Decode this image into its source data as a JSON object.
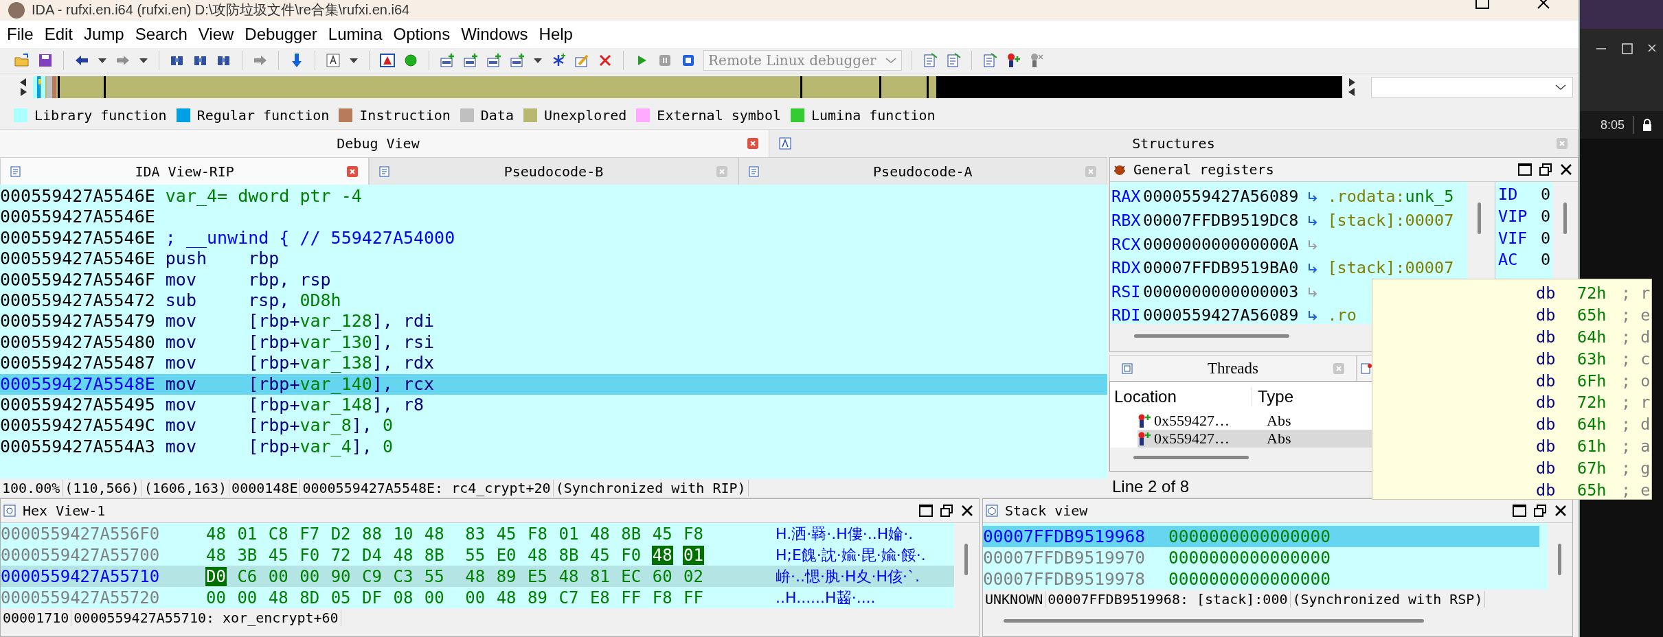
{
  "window": {
    "title": "IDA - rufxi.en.i64 (rufxi.en) D:\\攻防垃圾文件\\re合集\\rufxi.en.i64"
  },
  "menu": [
    "File",
    "Edit",
    "Jump",
    "Search",
    "View",
    "Debugger",
    "Lumina",
    "Options",
    "Windows",
    "Help"
  ],
  "toolbar": {
    "debugger_select": {
      "value": "Remote Linux debugger",
      "disabled": true
    }
  },
  "legend": [
    {
      "label": "Library function",
      "color": "#aaffff"
    },
    {
      "label": "Regular function",
      "color": "#00a0e6"
    },
    {
      "label": "Instruction",
      "color": "#b87c5c"
    },
    {
      "label": "Data",
      "color": "#c0c0c0"
    },
    {
      "label": "Unexplored",
      "color": "#b8b870"
    },
    {
      "label": "External symbol",
      "color": "#ffaaff"
    },
    {
      "label": "Lumina function",
      "color": "#33cc33"
    }
  ],
  "outer_tabs": [
    {
      "label": "Debug View",
      "selected": true
    },
    {
      "label": "Structures",
      "selected": false
    }
  ],
  "view_tabs": [
    {
      "label": "IDA View-RIP",
      "selected": true
    },
    {
      "label": "Pseudocode-B",
      "selected": false
    },
    {
      "label": "Pseudocode-A",
      "selected": false
    }
  ],
  "disassembly": [
    {
      "address": "000559427A5546E",
      "selected": false,
      "parts": [
        {
          "text": "var_4= dword ptr -4",
          "kind": "name"
        }
      ]
    },
    {
      "address": "000559427A5546E",
      "selected": false
    },
    {
      "address": "000559427A5546E",
      "selected": false,
      "parts": [
        {
          "text": "; __unwind { // 559427A54000",
          "kind": "comment"
        }
      ]
    },
    {
      "address": "000559427A5546E",
      "selected": false,
      "parts": [
        {
          "text": "push    rbp",
          "kind": "code"
        }
      ]
    },
    {
      "address": "000559427A5546F",
      "selected": false,
      "parts": [
        {
          "text": "mov     rbp, rsp",
          "kind": "code"
        }
      ]
    },
    {
      "address": "000559427A55472",
      "selected": false,
      "parts": [
        {
          "text": "sub     rsp, ",
          "kind": "code"
        },
        {
          "text": "0D8h",
          "kind": "number"
        }
      ]
    },
    {
      "address": "000559427A55479",
      "selected": false,
      "parts": [
        {
          "text": "mov     [rbp+",
          "kind": "code"
        },
        {
          "text": "var_128",
          "kind": "name"
        },
        {
          "text": "], rdi",
          "kind": "code"
        }
      ]
    },
    {
      "address": "000559427A55480",
      "selected": false,
      "parts": [
        {
          "text": "mov     [rbp+",
          "kind": "code"
        },
        {
          "text": "var_130",
          "kind": "name"
        },
        {
          "text": "], rsi",
          "kind": "code"
        }
      ]
    },
    {
      "address": "000559427A55487",
      "selected": false,
      "parts": [
        {
          "text": "mov     [rbp+",
          "kind": "code"
        },
        {
          "text": "var_138",
          "kind": "name"
        },
        {
          "text": "], rdx",
          "kind": "code"
        }
      ]
    },
    {
      "address": "000559427A5548E",
      "selected": true,
      "parts": [
        {
          "text": "mov     [rbp+",
          "kind": "code"
        },
        {
          "text": "var_140",
          "kind": "name"
        },
        {
          "text": "], rcx",
          "kind": "code"
        }
      ]
    },
    {
      "address": "000559427A55495",
      "selected": false,
      "parts": [
        {
          "text": "mov     [rbp+",
          "kind": "code"
        },
        {
          "text": "var_148",
          "kind": "name"
        },
        {
          "text": "], r8",
          "kind": "code"
        }
      ]
    },
    {
      "address": "000559427A5549C",
      "selected": false,
      "parts": [
        {
          "text": "mov     [rbp+",
          "kind": "code"
        },
        {
          "text": "var_8",
          "kind": "name"
        },
        {
          "text": "], ",
          "kind": "code"
        },
        {
          "text": "0",
          "kind": "number"
        }
      ]
    },
    {
      "address": "000559427A554A3",
      "selected": false,
      "parts": [
        {
          "text": "mov     [rbp+",
          "kind": "code"
        },
        {
          "text": "var_4",
          "kind": "name"
        },
        {
          "text": "], ",
          "kind": "code"
        },
        {
          "text": "0",
          "kind": "number"
        }
      ]
    }
  ],
  "disassembly_status": [
    "100.00%",
    "(110,566)",
    "(1606,163)",
    "0000148E",
    "0000559427A5548E: rc4_crypt+20",
    "(Synchronized with RIP)"
  ],
  "registers": {
    "title": "General registers",
    "rows": [
      {
        "name": "RAX",
        "value": "0000559427A56089",
        "points": true,
        "parts": [
          {
            "text": ".rodata:",
            "kind": "segment"
          },
          {
            "text": "unk_5",
            "kind": "name"
          }
        ]
      },
      {
        "name": "RBX",
        "value": "00007FFDB9519DC8",
        "points": true,
        "parts": [
          {
            "text": "[stack]:00007",
            "kind": "segment"
          }
        ]
      },
      {
        "name": "RCX",
        "value": "000000000000000A",
        "points": false
      },
      {
        "name": "RDX",
        "value": "00007FFDB9519BA0",
        "points": true,
        "parts": [
          {
            "text": "[stack]:00007",
            "kind": "segment"
          }
        ]
      },
      {
        "name": "RSI",
        "value": "0000000000000003",
        "points": false
      },
      {
        "name": "RDI",
        "value": "0000559427A56089",
        "points": true,
        "parts": [
          {
            "text": ".ro",
            "kind": "segment"
          }
        ]
      }
    ],
    "flags": [
      {
        "name": "ID",
        "value": "0"
      },
      {
        "name": "VIP",
        "value": "0"
      },
      {
        "name": "VIF",
        "value": "0"
      },
      {
        "name": "AC",
        "value": "0"
      }
    ]
  },
  "threads": {
    "tab": "Threads",
    "columns": [
      "Location",
      "Type"
    ],
    "rows": [
      {
        "location": "0x559427…",
        "type": "Abs",
        "selected": false
      },
      {
        "location": "0x559427…",
        "type": "Abs",
        "selected": true
      }
    ],
    "status": "Line 2 of 8"
  },
  "hint": [
    {
      "op": "db",
      "value": "72h",
      "comment": "; r"
    },
    {
      "op": "db",
      "value": "65h",
      "comment": "; e"
    },
    {
      "op": "db",
      "value": "64h",
      "comment": "; d"
    },
    {
      "op": "db",
      "value": "63h",
      "comment": "; c"
    },
    {
      "op": "db",
      "value": "6Fh",
      "comment": "; o"
    },
    {
      "op": "db",
      "value": "72h",
      "comment": "; r"
    },
    {
      "op": "db",
      "value": "64h",
      "comment": "; d"
    },
    {
      "op": "db",
      "value": "61h",
      "comment": "; a"
    },
    {
      "op": "db",
      "value": "67h",
      "comment": "; g"
    },
    {
      "op": "db",
      "value": "65h",
      "comment": "; e"
    }
  ],
  "hex": {
    "title": "Hex View-1",
    "rows": [
      {
        "address": "0000559427A556F0",
        "selected": false,
        "ascii": "H.洒·羇·.H僂·..H婨·.",
        "bytes": [
          {
            "byte": "48",
            "highlighted": false
          },
          {
            "byte": "01",
            "highlighted": false
          },
          {
            "byte": "C8",
            "highlighted": false
          },
          {
            "byte": "F7",
            "highlighted": false
          },
          {
            "byte": "D2",
            "highlighted": false
          },
          {
            "byte": "88",
            "highlighted": false
          },
          {
            "byte": "10",
            "highlighted": false
          },
          {
            "byte": "48",
            "highlighted": false
          },
          {
            "byte": "83",
            "highlighted": false
          },
          {
            "byte": "45",
            "highlighted": false
          },
          {
            "byte": "F8",
            "highlighted": false
          },
          {
            "byte": "01",
            "highlighted": false
          },
          {
            "byte": "48",
            "highlighted": false
          },
          {
            "byte": "8B",
            "highlighted": false
          },
          {
            "byte": "45",
            "highlighted": false
          },
          {
            "byte": "F8",
            "highlighted": false
          }
        ]
      },
      {
        "address": "0000559427A55700",
        "selected": false,
        "ascii": "H;E餽·訦·婾·毘·婾·餒·.",
        "bytes": [
          {
            "byte": "48",
            "highlighted": false
          },
          {
            "byte": "3B",
            "highlighted": false
          },
          {
            "byte": "45",
            "highlighted": false
          },
          {
            "byte": "F0",
            "highlighted": false
          },
          {
            "byte": "72",
            "highlighted": false
          },
          {
            "byte": "D4",
            "highlighted": false
          },
          {
            "byte": "48",
            "highlighted": false
          },
          {
            "byte": "8B",
            "highlighted": false
          },
          {
            "byte": "55",
            "highlighted": false
          },
          {
            "byte": "E0",
            "highlighted": false
          },
          {
            "byte": "48",
            "highlighted": false
          },
          {
            "byte": "8B",
            "highlighted": false
          },
          {
            "byte": "45",
            "highlighted": false
          },
          {
            "byte": "F0",
            "highlighted": false
          },
          {
            "byte": "48",
            "highlighted": true
          },
          {
            "byte": "01",
            "highlighted": true
          }
        ]
      },
      {
        "address": "0000559427A55710",
        "selected": true,
        "ascii": "峅·..愢·肒·H夊·H侅·`.",
        "bytes": [
          {
            "byte": "D0",
            "highlighted": true
          },
          {
            "byte": "C6",
            "highlighted": false
          },
          {
            "byte": "00",
            "highlighted": false
          },
          {
            "byte": "00",
            "highlighted": false
          },
          {
            "byte": "90",
            "highlighted": false
          },
          {
            "byte": "C9",
            "highlighted": false
          },
          {
            "byte": "C3",
            "highlighted": false
          },
          {
            "byte": "55",
            "highlighted": false
          },
          {
            "byte": "48",
            "highlighted": false
          },
          {
            "byte": "89",
            "highlighted": false
          },
          {
            "byte": "E5",
            "highlighted": false
          },
          {
            "byte": "48",
            "highlighted": false
          },
          {
            "byte": "81",
            "highlighted": false
          },
          {
            "byte": "EC",
            "highlighted": false
          },
          {
            "byte": "60",
            "highlighted": false
          },
          {
            "byte": "02",
            "highlighted": false
          }
        ]
      },
      {
        "address": "0000559427A55720",
        "selected": false,
        "ascii": "..H......H齧·....",
        "bytes": [
          {
            "byte": "00",
            "highlighted": false
          },
          {
            "byte": "00",
            "highlighted": false
          },
          {
            "byte": "48",
            "highlighted": false
          },
          {
            "byte": "8D",
            "highlighted": false
          },
          {
            "byte": "05",
            "highlighted": false
          },
          {
            "byte": "DF",
            "highlighted": false
          },
          {
            "byte": "08",
            "highlighted": false
          },
          {
            "byte": "00",
            "highlighted": false
          },
          {
            "byte": "00",
            "highlighted": false
          },
          {
            "byte": "48",
            "highlighted": false
          },
          {
            "byte": "89",
            "highlighted": false
          },
          {
            "byte": "C7",
            "highlighted": false
          },
          {
            "byte": "E8",
            "highlighted": false
          },
          {
            "byte": "FF",
            "highlighted": false
          },
          {
            "byte": "F8",
            "highlighted": false
          },
          {
            "byte": "FF",
            "highlighted": false
          }
        ]
      }
    ],
    "status": [
      "00001710",
      "0000559427A55710: xor_encrypt+60"
    ]
  },
  "stack": {
    "title": "Stack view",
    "rows": [
      {
        "address": "00007FFDB9519968",
        "value": "0000000000000000",
        "selected": true
      },
      {
        "address": "00007FFDB9519970",
        "value": "0000000000000000",
        "selected": false
      },
      {
        "address": "00007FFDB9519978",
        "value": "0000000000000000",
        "selected": false
      }
    ],
    "status": [
      "UNKNOWN",
      "00007FFDB9519968: [stack]:000",
      "(Synchronized with RSP)"
    ]
  },
  "desktop": {
    "clock": "8:05"
  }
}
